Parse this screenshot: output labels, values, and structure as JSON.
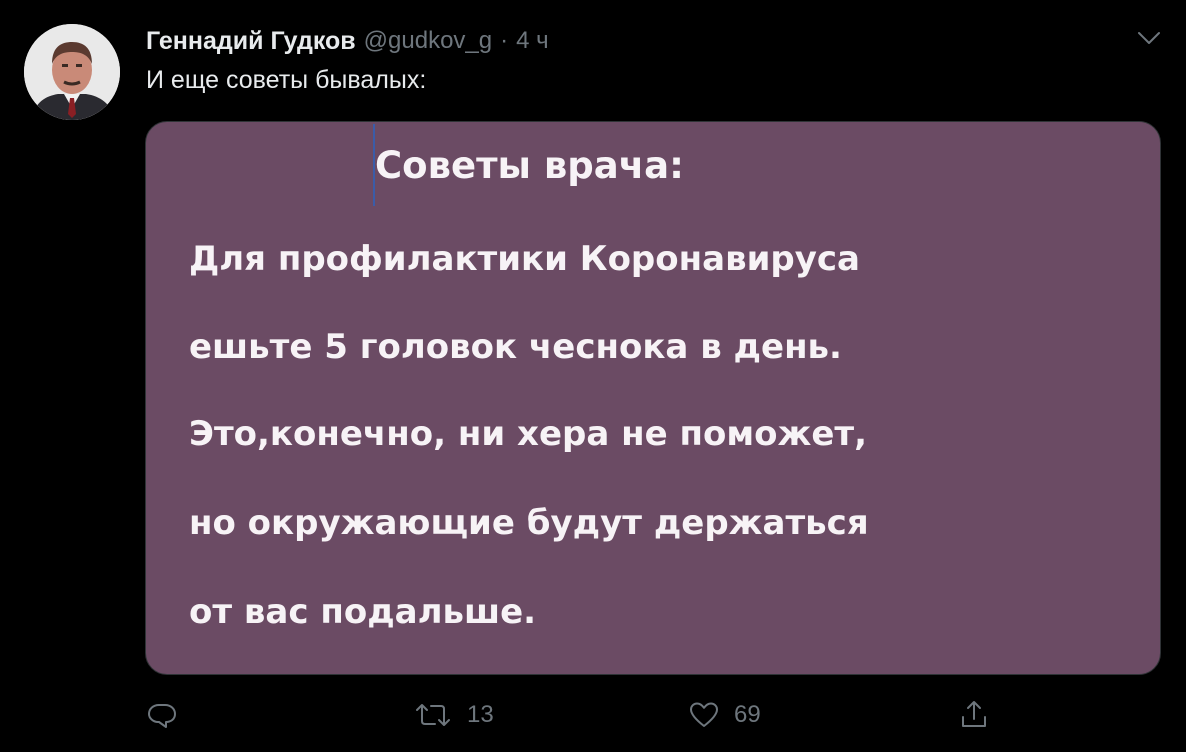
{
  "tweet": {
    "author_name": "Геннадий Гудков",
    "author_handle": "@gudkov_g",
    "separator": "·",
    "time_ago": "4 ч",
    "text": "И еще советы бывалых:",
    "media": {
      "title": "Советы врача:",
      "lines": [
        "Для профилактики Коронавируса",
        "ешьте 5 головок чеснока в день.",
        "Это,конечно, ни хера не поможет,",
        "но окружающие будут держаться",
        "от вас подальше."
      ],
      "background_color": "#6b4b64"
    },
    "actions": {
      "reply": {
        "icon": "reply-icon",
        "count": ""
      },
      "retweet": {
        "icon": "retweet-icon",
        "count": "13"
      },
      "like": {
        "icon": "heart-icon",
        "count": "69"
      },
      "share": {
        "icon": "share-icon",
        "count": ""
      }
    }
  },
  "colors": {
    "background": "#000000",
    "primary_text": "#e8ebed",
    "secondary_text": "#6e767d"
  }
}
